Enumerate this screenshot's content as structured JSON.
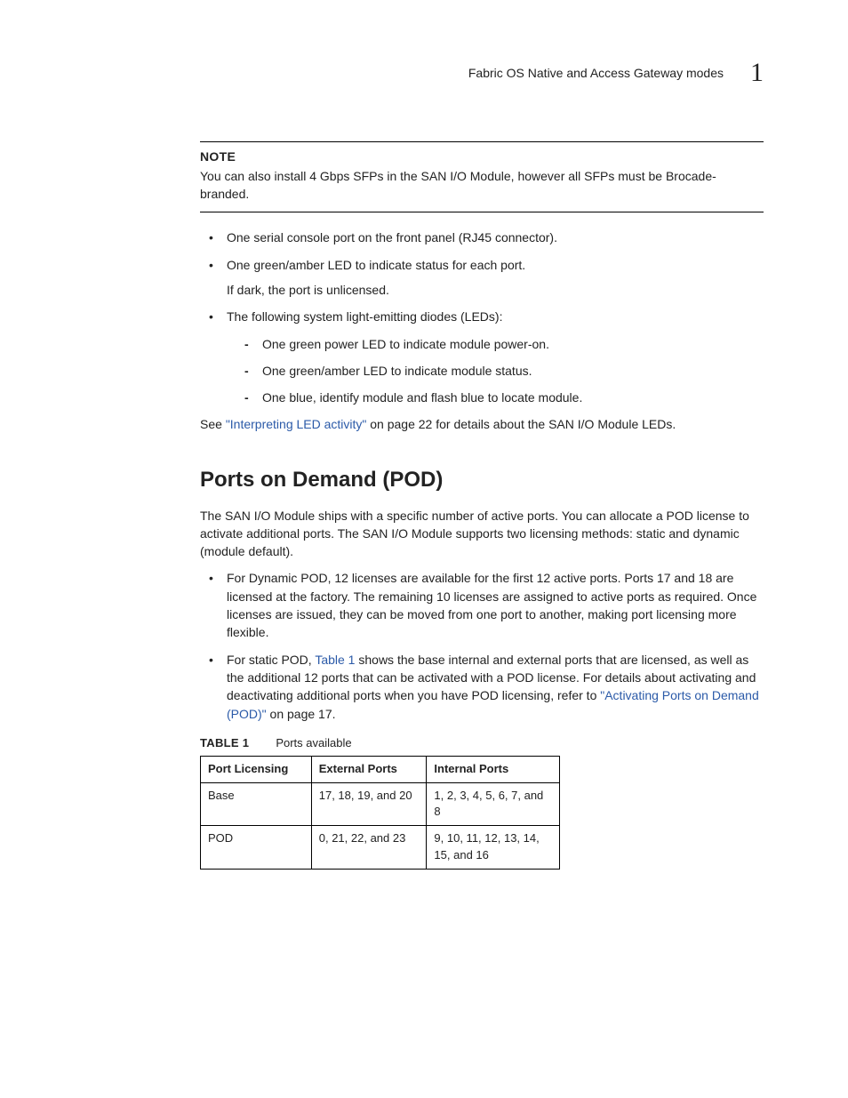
{
  "header": {
    "running_title": "Fabric OS Native and Access Gateway modes",
    "chapter_number": "1"
  },
  "note": {
    "label": "NOTE",
    "body": "You can also install 4 Gbps SFPs in the SAN I/O Module, however all SFPs must be Brocade-branded."
  },
  "bullets_top": {
    "b1": "One serial console port on the front panel (RJ45 connector).",
    "b2_main": "One green/amber LED to indicate status for each port.",
    "b2_sub": "If dark, the port is unlicensed.",
    "b3_main": "The following system light-emitting diodes (LEDs):",
    "b3_d1": "One green power LED to indicate module power-on.",
    "b3_d2": "One green/amber LED to indicate module status.",
    "b3_d3": "One blue, identify module and flash blue to locate module."
  },
  "see_led": {
    "pre": "See ",
    "link": "\"Interpreting LED activity\"",
    "post": " on page 22 for details about the SAN I/O Module LEDs."
  },
  "pod": {
    "heading": "Ports on Demand (POD)",
    "intro": "The SAN I/O Module ships with a specific number of active ports. You can allocate a POD license to activate additional ports. The SAN I/O Module supports two licensing methods: static and dynamic (module default).",
    "b1": "For Dynamic POD, 12 licenses are available for the first 12 active ports. Ports 17 and 18 are licensed at the factory. The remaining 10 licenses are assigned to active ports as required. Once licenses are issued, they can be moved from one port to another, making port licensing more flexible.",
    "b2_pre": "For static POD, ",
    "b2_link1": "Table 1",
    "b2_mid": " shows the base internal and external ports that are licensed, as well as the additional 12 ports that can be activated with a POD license. For details about activating and deactivating additional ports when you have POD licensing, refer to ",
    "b2_link2": "\"Activating Ports on Demand (POD)\"",
    "b2_post": " on page 17."
  },
  "table": {
    "label": "TABLE 1",
    "caption": "Ports available",
    "head": {
      "c1": "Port Licensing",
      "c2": "External Ports",
      "c3": "Internal Ports"
    },
    "r1": {
      "c1": "Base",
      "c2": "17, 18, 19, and 20",
      "c3": "1, 2, 3, 4, 5, 6, 7, and 8"
    },
    "r2": {
      "c1": "POD",
      "c2": "0, 21, 22, and 23",
      "c3": "9, 10, 11, 12, 13, 14, 15, and 16"
    }
  }
}
